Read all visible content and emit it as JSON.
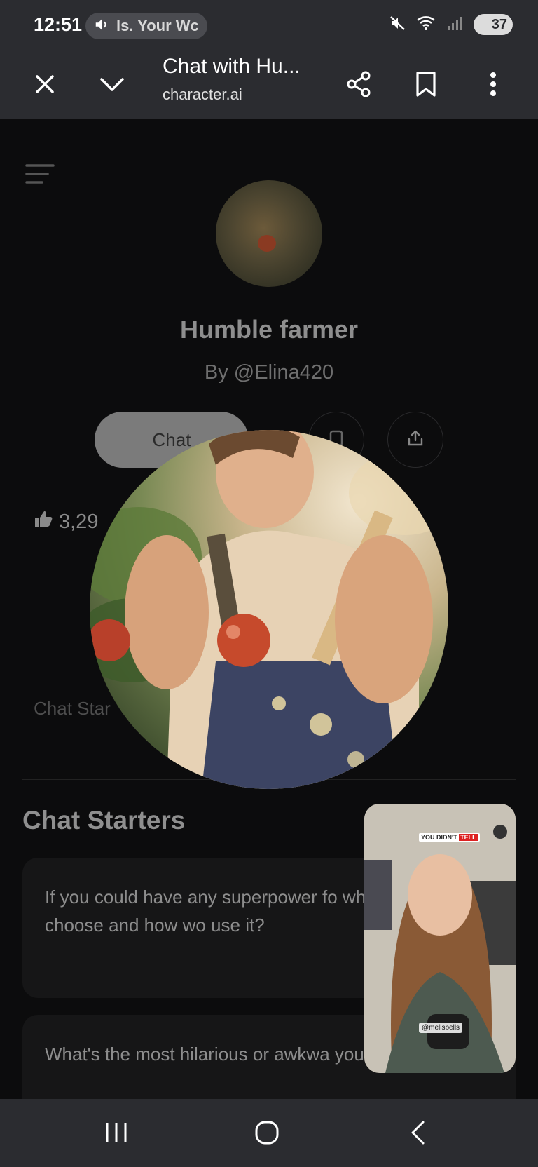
{
  "status_bar": {
    "time": "12:51",
    "media_text": "ls. Your Wc",
    "battery": "37",
    "icons": [
      "volume-icon",
      "mute-icon",
      "wifi-icon",
      "signal-icon",
      "battery-icon"
    ]
  },
  "tab_bar": {
    "title": "Chat with Hu...",
    "url": "character.ai",
    "icons": [
      "close-icon",
      "chevron-down-icon",
      "share-icon",
      "bookmark-icon",
      "more-vert-icon"
    ]
  },
  "character": {
    "name": "Humble farmer",
    "author": "By @Elina420",
    "chat_label": "Chat",
    "likes": "3,29",
    "faded_label": "Chat Star"
  },
  "chat_starters": {
    "title": "Chat Starters",
    "items": [
      "If you could have any superpower fo what would you choose and how wo use it?",
      "What's the most hilarious or awkwa you've got?"
    ]
  },
  "video_overlay": {
    "caption_prefix": "YOU DIDN'T",
    "caption_highlight": "TELL",
    "handle": "@mellsbells"
  },
  "colors": {
    "chrome_bg": "#2b2c30",
    "page_bg": "#0c0c0d",
    "chat_button": "#7b7b7b"
  }
}
